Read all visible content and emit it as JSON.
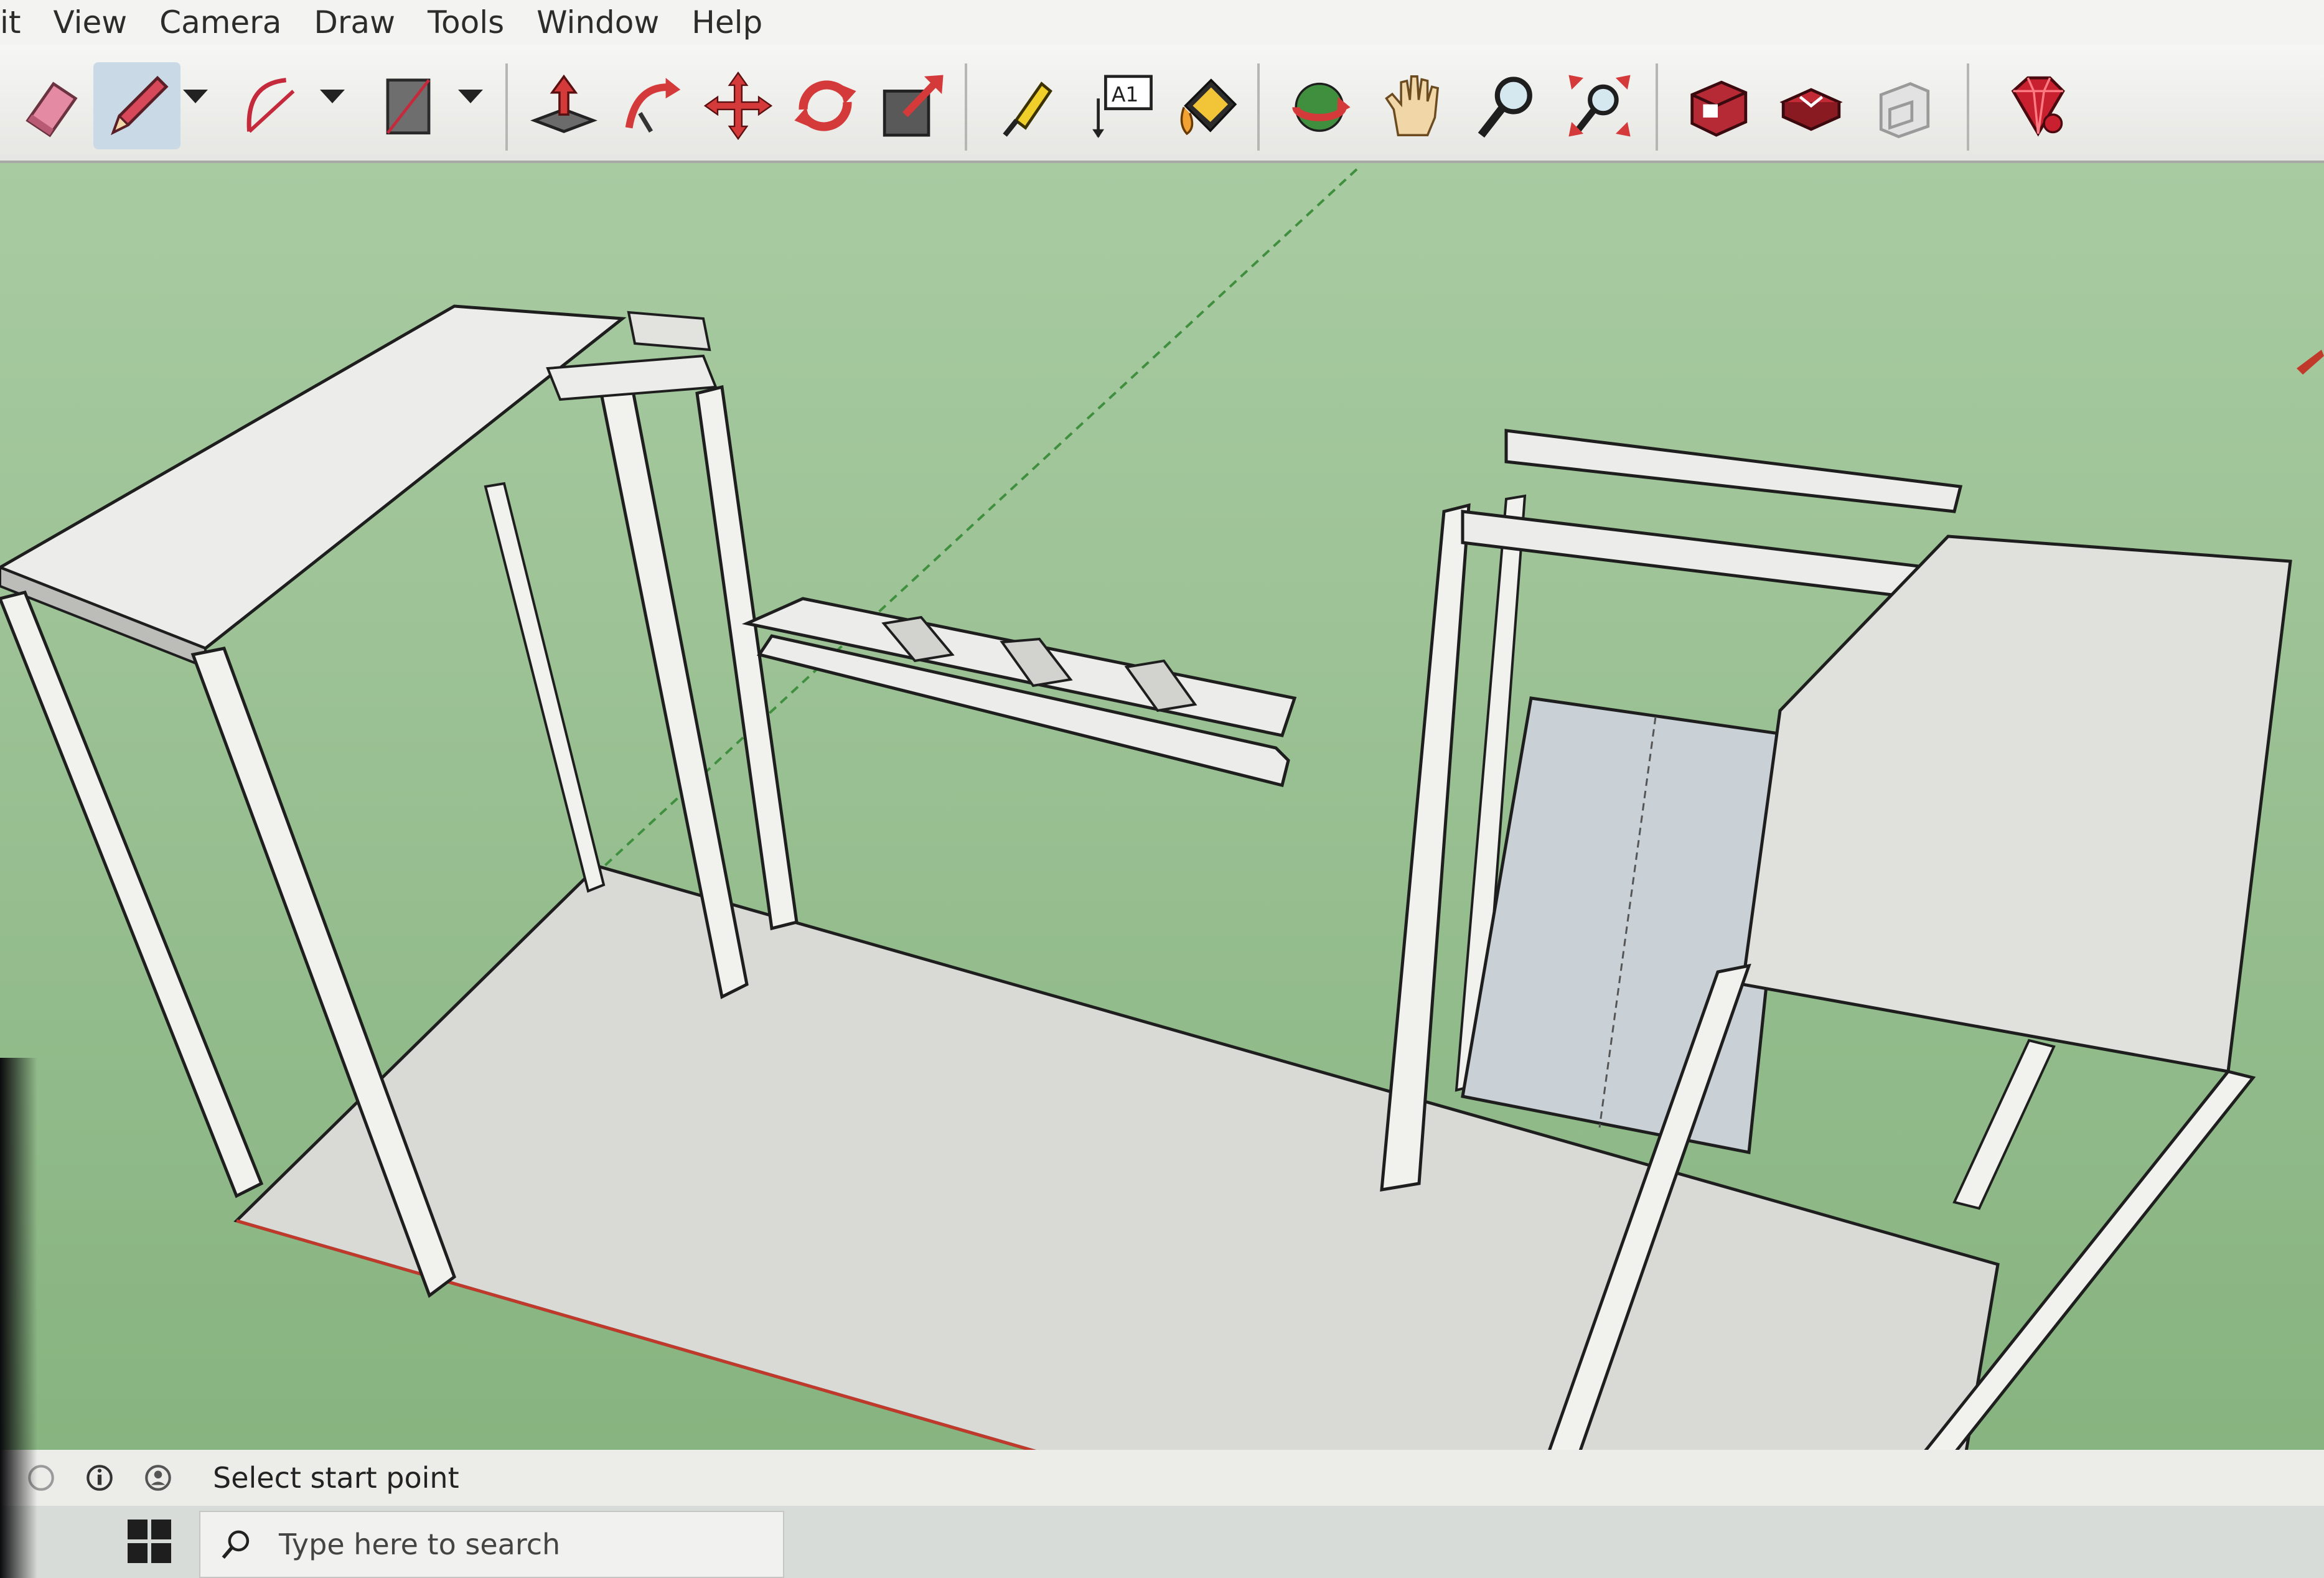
{
  "menubar": {
    "items": [
      {
        "label": "it"
      },
      {
        "label": "View"
      },
      {
        "label": "Camera"
      },
      {
        "label": "Draw"
      },
      {
        "label": "Tools"
      },
      {
        "label": "Window"
      },
      {
        "label": "Help"
      }
    ]
  },
  "toolbar": {
    "tools": [
      {
        "icon": "eraser-icon"
      },
      {
        "icon": "pencil-icon",
        "active": true
      },
      {
        "icon": "arc-icon"
      },
      {
        "icon": "rectangle-icon"
      },
      {
        "icon": "push-pull-icon"
      },
      {
        "icon": "follow-me-icon"
      },
      {
        "icon": "move-icon"
      },
      {
        "icon": "rotate-icon"
      },
      {
        "icon": "scale-icon"
      },
      {
        "icon": "tape-measure-icon"
      },
      {
        "icon": "text-icon",
        "label": "A1"
      },
      {
        "icon": "paint-bucket-icon"
      },
      {
        "icon": "orbit-icon"
      },
      {
        "icon": "pan-icon"
      },
      {
        "icon": "zoom-icon"
      },
      {
        "icon": "zoom-extents-icon"
      },
      {
        "icon": "warehouse-icon"
      },
      {
        "icon": "extension-warehouse-icon"
      },
      {
        "icon": "layout-icon"
      },
      {
        "icon": "ruby-icon"
      }
    ]
  },
  "status": {
    "text": "Select start point"
  },
  "taskbar": {
    "search_placeholder": "Type here to search"
  },
  "colors": {
    "ground": "#8fb888",
    "face": "#e9e9e6",
    "edge": "#1e1e1e",
    "toolbar_bg": "#ececea",
    "active_tool": "#c9d9e6",
    "axis_red": "#c0392b",
    "axis_green": "#3f8f3f"
  }
}
